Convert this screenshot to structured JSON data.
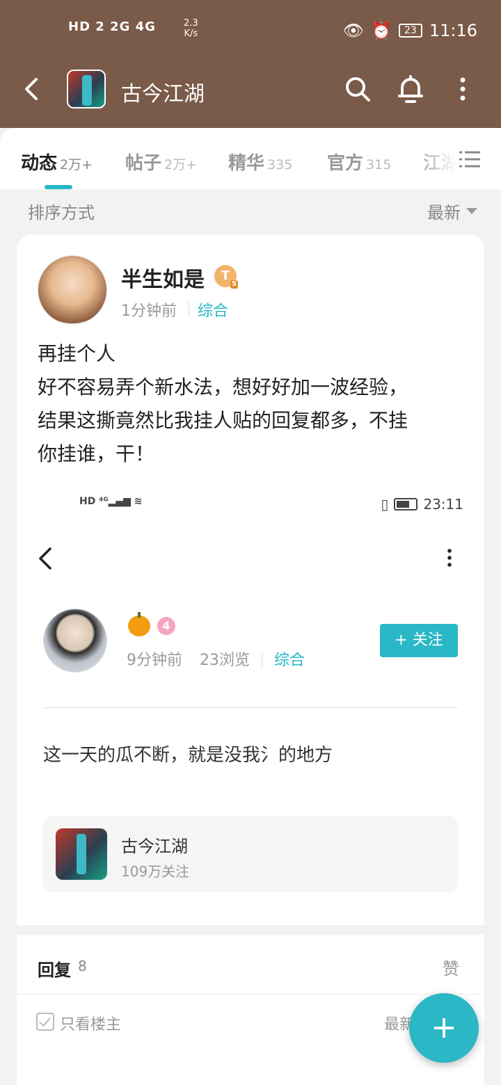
{
  "status_bar": {
    "network_text": "HD 2 2G 4G",
    "speed_value": "2.3",
    "speed_unit": "K/s",
    "battery": "23",
    "time": "11:16"
  },
  "app_bar": {
    "title": "古今江湖"
  },
  "tabs": [
    {
      "label": "动态",
      "count": "2万+"
    },
    {
      "label": "帖子",
      "count": "2万+"
    },
    {
      "label": "精华",
      "count": "335"
    },
    {
      "label": "官方",
      "count": "315"
    },
    {
      "label": "江湖",
      "count": ""
    }
  ],
  "sort": {
    "label": "排序方式",
    "value": "最新"
  },
  "post": {
    "username": "半生如是",
    "level": "T",
    "level_sub": "5",
    "time": "1分钟前",
    "category": "综合",
    "lines": [
      "再挂个人",
      "好不容易弄个新水法，想好好加一波经验，",
      "结果这撕竟然比我挂人贴的回复都多，不挂",
      "你挂谁，干！"
    ]
  },
  "screenshot": {
    "status_time": "23:11",
    "level": "4",
    "time": "9分钟前",
    "views": "23浏览",
    "category": "综合",
    "follow_label": "+ 关注",
    "text": "这一天的瓜不断，就是没我氵的地方",
    "game_name": "古今江湖",
    "game_followers": "109万关注",
    "reply_label": "回复",
    "reply_count": "8",
    "like_label": "赞",
    "only_author": "只看楼主",
    "sort_latest": "最新"
  },
  "colors": {
    "header_bg": "#7a5a48",
    "accent": "#27b8c8"
  }
}
